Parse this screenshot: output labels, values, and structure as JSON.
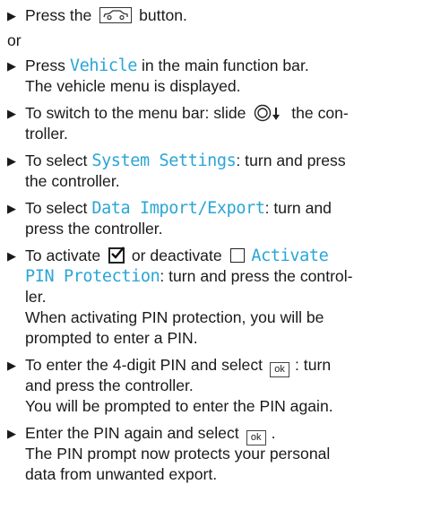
{
  "instructions": {
    "step1_press": "Press the",
    "step1_button": "button.",
    "or": "or",
    "step2_press": "Press",
    "step2_kw": "Vehicle",
    "step2_rest": "in the main function bar.",
    "step2_result": "The vehicle menu is displayed.",
    "step3_a": "To switch to the menu bar: slide",
    "step3_b": "the con-",
    "step3_c": "troller.",
    "step4_a": "To select",
    "step4_kw": "System Settings",
    "step4_b": ": turn and press",
    "step4_c": "the controller.",
    "step5_a": "To select",
    "step5_kw": "Data Import/Export",
    "step5_b": ": turn and",
    "step5_c": "press the controller.",
    "step6_a": "To activate",
    "step6_b": "or deactivate",
    "step6_kw1": "Activate",
    "step6_kw2": "PIN Protection",
    "step6_c": ": turn and press the control-",
    "step6_d": "ler.",
    "step6_result1": "When activating PIN protection, you will be",
    "step6_result2": "prompted to enter a PIN.",
    "step7_a": "To enter the 4-digit PIN and select",
    "step7_ok": "ok",
    "step7_b": ": turn",
    "step7_c": "and press the controller.",
    "step7_result": "You will be prompted to enter the PIN again.",
    "step8_a": "Enter the PIN again and select",
    "step8_ok": "ok",
    "step8_b": ".",
    "step8_result1": "The PIN prompt now protects your personal",
    "step8_result2": "data from unwanted export."
  },
  "icons": {
    "bullet": "right-pointing-triangle",
    "vehicle_button": "car-icon",
    "controller_slide": "controller-slide-down-icon",
    "checkbox_checked": "checkbox-checked-icon",
    "checkbox_empty": "checkbox-empty-icon",
    "ok_key": "ok-key-icon"
  },
  "colors": {
    "text": "#1a1a1a",
    "keyword": "#2aa5d6"
  }
}
